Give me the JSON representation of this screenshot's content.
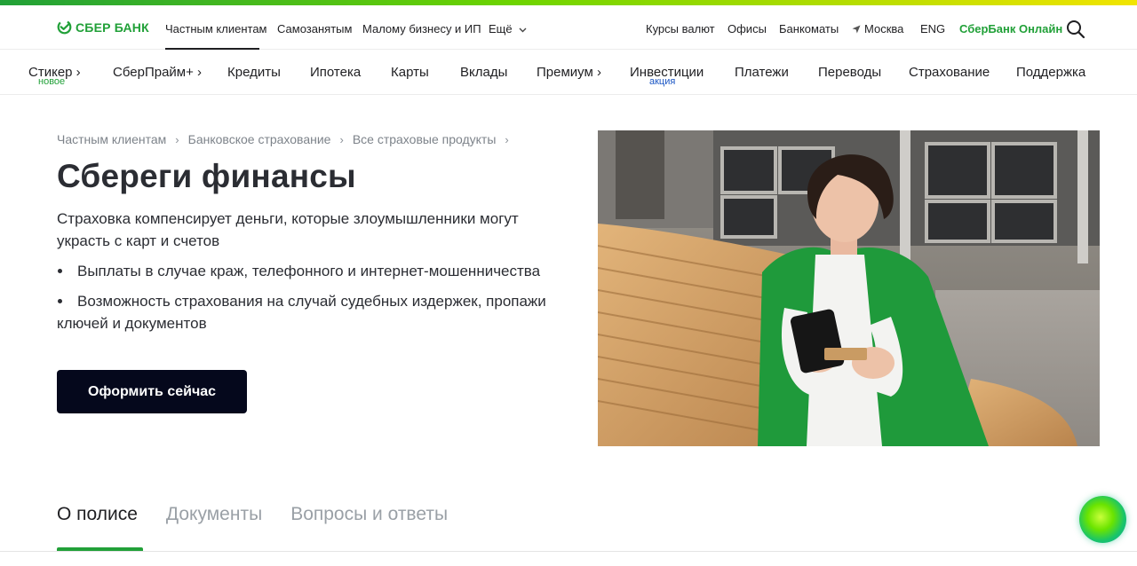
{
  "header": {
    "logo_text": "СБЕР БАНК",
    "nav": [
      "Частным клиентам",
      "Самозанятым",
      "Малому бизнесу и ИП",
      "Ещё"
    ],
    "right": [
      "Курсы валют",
      "Офисы",
      "Банкоматы",
      "Москва",
      "ENG",
      "СберБанк Онлайн"
    ],
    "colors": {
      "brand": "#21a038",
      "text": "#1f1f22"
    }
  },
  "main_nav": {
    "items": [
      {
        "label": "Стикер",
        "has_arrow": true,
        "tag": "новое"
      },
      {
        "label": "СберПрайм+",
        "has_arrow": true
      },
      {
        "label": "Кредиты"
      },
      {
        "label": "Ипотека"
      },
      {
        "label": "Карты"
      },
      {
        "label": "Вклады"
      },
      {
        "label": "Премиум",
        "has_arrow": true
      },
      {
        "label": "Инвестиции",
        "tag": "акция"
      },
      {
        "label": "Платежи"
      },
      {
        "label": "Переводы"
      },
      {
        "label": "Страхование"
      },
      {
        "label": "Поддержка"
      }
    ]
  },
  "breadcrumb": [
    "Частным клиентам",
    "Банковское страхование",
    "Все страховые продукты"
  ],
  "hero": {
    "title": "Сбереги финансы",
    "lead": "Страховка компенсирует деньги, которые злоумышленники могут украсть с карт и счетов",
    "bullets": [
      "Выплаты в случае краж, телефонного и интернет-мошенничества",
      "Возможность страхования на случай судебных издержек, пропажи ключей и документов"
    ],
    "cta_label": "Оформить сейчас"
  },
  "tabs": [
    "О полисе",
    "Документы",
    "Вопросы и ответы"
  ],
  "icons": {
    "logo": "sber-logo-icon",
    "location": "location-arrow-icon",
    "search": "search-icon",
    "more": "chevron-down-icon",
    "assistant": "virtual-assistant-icon"
  }
}
